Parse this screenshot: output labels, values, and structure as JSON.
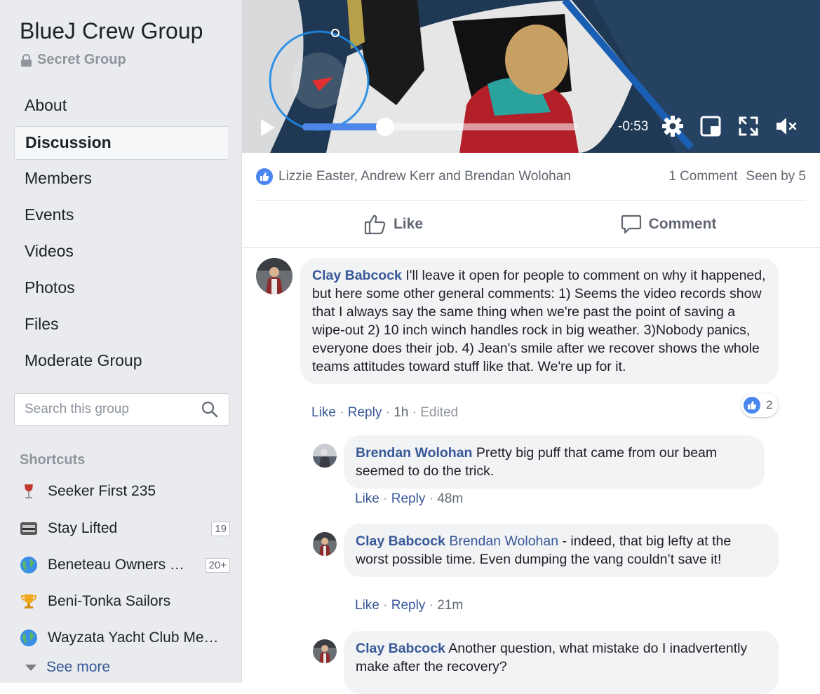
{
  "sidebar": {
    "group_name": "BlueJ Crew Group",
    "privacy": "Secret Group",
    "nav": [
      {
        "label": "About"
      },
      {
        "label": "Discussion"
      },
      {
        "label": "Members"
      },
      {
        "label": "Events"
      },
      {
        "label": "Videos"
      },
      {
        "label": "Photos"
      },
      {
        "label": "Files"
      },
      {
        "label": "Moderate Group"
      }
    ],
    "active_nav": "Discussion",
    "search_placeholder": "Search this group",
    "shortcuts_title": "Shortcuts",
    "shortcuts": [
      {
        "label": "Seeker First 235",
        "icon": "wine-glass-icon",
        "badge": ""
      },
      {
        "label": "Stay Lifted",
        "icon": "photo-thumb-icon",
        "badge": "19"
      },
      {
        "label": "Beneteau Owners …",
        "icon": "globe-icon",
        "badge": "20+"
      },
      {
        "label": "Beni-Tonka Sailors",
        "icon": "trophy-icon",
        "badge": ""
      },
      {
        "label": "Wayzata Yacht Club Me…",
        "icon": "globe-icon",
        "badge": ""
      }
    ],
    "see_more": "See more"
  },
  "video": {
    "progress": 0.3,
    "time_remaining": "-0:53",
    "controls": [
      "play-icon",
      "gear-icon",
      "pip-icon",
      "fullscreen-icon",
      "muted-speaker-icon"
    ]
  },
  "post": {
    "reactions_names": "Lizzie Easter, Andrew Kerr and Brendan Wolohan",
    "comment_count": "1 Comment",
    "seen_by": "Seen by 5",
    "like_label": "Like",
    "comment_label": "Comment"
  },
  "comments": [
    {
      "author": "Clay Babcock",
      "text": "I'll leave it open for people to comment on why it happened, but here some other general comments: 1) Seems the video records show that I always say the same thing when we're past the point of saving a wipe-out 2) 10 inch winch handles rock in big weather. 3)Nobody panics, everyone does their job. 4) Jean's smile after we recover shows the whole teams attitudes toward stuff like that. We're up for it.",
      "like": "Like",
      "reply": "Reply",
      "time": "1h",
      "edited": "Edited",
      "reaction_count": "2"
    },
    {
      "author": "Brendan Wolohan",
      "text": "Pretty big puff that came from our beam seemed to do the trick.",
      "like": "Like",
      "reply": "Reply",
      "time": "48m"
    },
    {
      "author": "Clay Babcock",
      "mention": "Brendan Wolohan",
      "text": "- indeed, that big lefty at the worst possible time. Even dumping the vang couldn’t save it!",
      "like": "Like",
      "reply": "Reply",
      "time": "21m"
    },
    {
      "author": "Clay Babcock",
      "text": "Another question, what mistake do I inadvertently make after the recovery?"
    }
  ],
  "colors": {
    "link": "#385898",
    "like_blue": "#4a86f0",
    "sidebar_bg": "#e9ebee"
  }
}
